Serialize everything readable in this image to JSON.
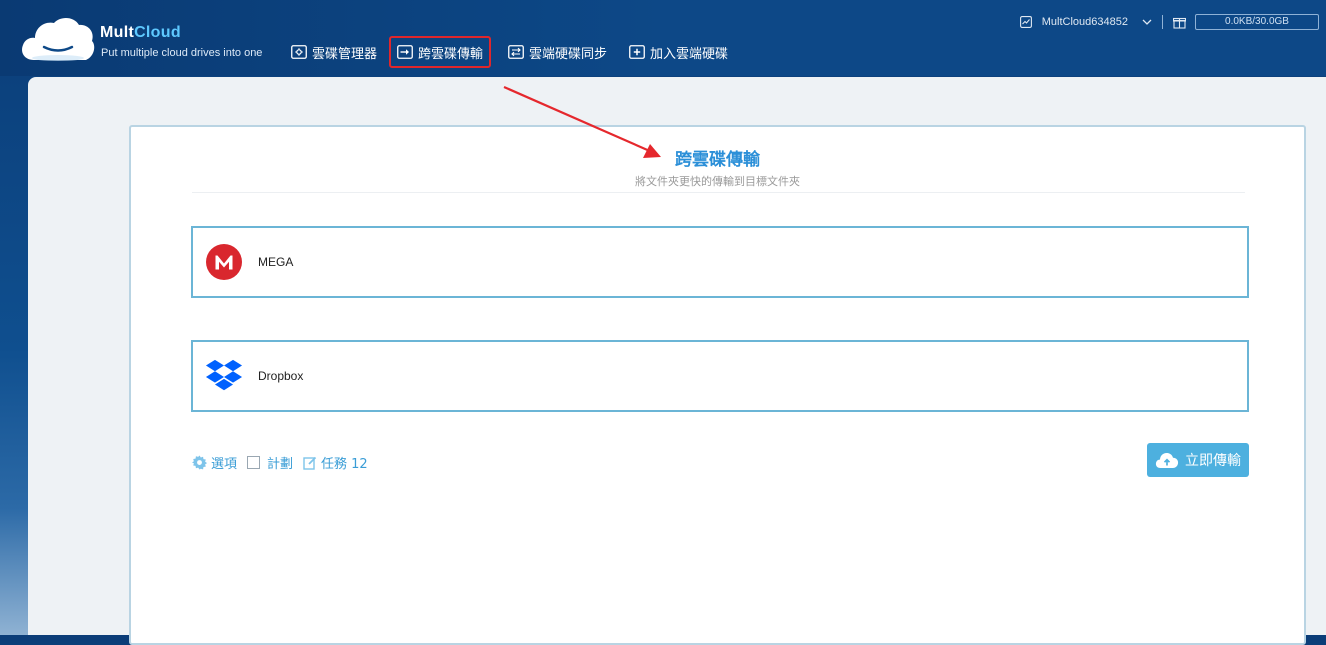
{
  "header": {
    "brand_prefix": "Mult",
    "brand_suffix": "Cloud",
    "tagline": "Put multiple cloud drives into one",
    "nav": [
      {
        "label": "雲碟管理器",
        "icon": "gear-icon"
      },
      {
        "label": "跨雲碟傳輸",
        "icon": "transfer-icon",
        "highlighted": true
      },
      {
        "label": "雲端硬碟同步",
        "icon": "sync-icon"
      },
      {
        "label": "加入雲端硬碟",
        "icon": "add-icon"
      }
    ],
    "username": "MultCloud634852",
    "storage": "0.0KB/30.0GB"
  },
  "card": {
    "title": "跨雲碟傳輸",
    "subtitle": "將文件夾更快的傳輸到目標文件夾",
    "source": {
      "name": "MEGA",
      "icon": "mega-icon",
      "color": "#d9272e"
    },
    "target": {
      "name": "Dropbox",
      "icon": "dropbox-icon",
      "color": "#0061fe"
    },
    "options_label": "選項",
    "schedule_label": "計劃",
    "tasks_label": "任務 12",
    "transfer_button": "立即傳輸"
  },
  "colors": {
    "accent": "#2b8fd8",
    "highlight_border": "#e0262b",
    "button": "#4db0df"
  }
}
